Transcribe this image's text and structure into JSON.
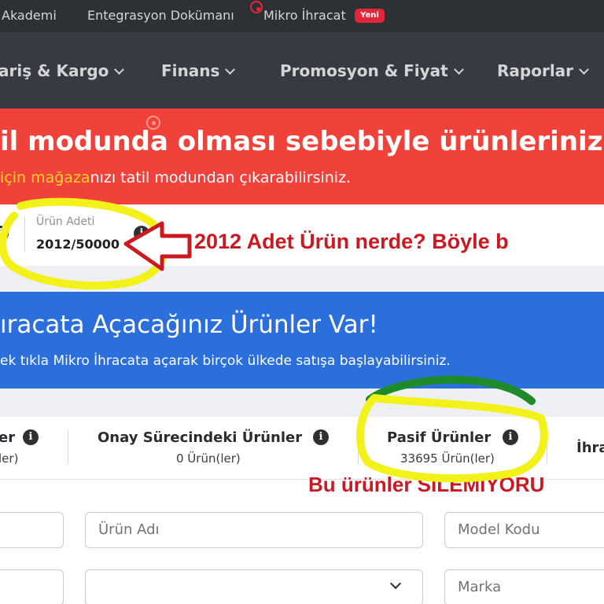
{
  "topbar": {
    "links": [
      "Akademi",
      "Entegrasyon Dokümanı",
      "Mikro İhracat"
    ],
    "new_badge": "Yeni"
  },
  "nav": {
    "items": [
      "ariş & Kargo",
      "Finans",
      "Promosyon & Fiyat",
      "Raporlar"
    ]
  },
  "vacation_banner": {
    "title": "il modunda olması sebebiyle ürünleriniz satış",
    "subtitle_highlight": "için mağaza",
    "subtitle_rest": "nızı tatil modundan çıkarabilirsiniz."
  },
  "product_count": {
    "label": "Ürün Adeti",
    "value": "2012/50000"
  },
  "annotations": {
    "where_products": "2012 Adet Ürün nerde? Böyle b",
    "cannot_delete": "Bu ürünler SİLEMİYORU"
  },
  "export_banner": {
    "title": "ıracata Açacağınız Ürünler Var!",
    "subtitle": "ek tıkla Mikro İhracata açarak birçok ülkede satışa başlayabilirsiniz."
  },
  "tabs": [
    {
      "title": "er",
      "sub": "ler)"
    },
    {
      "title": "Onay Sürecindeki Ürünler",
      "sub": "0 Ürün(ler)"
    },
    {
      "title": "Pasif Ürünler",
      "sub": "33695 Ürün(ler)"
    },
    {
      "title": "İhra",
      "sub": ""
    }
  ],
  "filters": {
    "product_name_placeholder": "Ürün Adı",
    "model_code_placeholder": "Model Kodu",
    "brand_placeholder": "Marka"
  },
  "colors": {
    "topbar_bg": "#2d3035",
    "navbar_bg": "#373b41",
    "vacation_red": "#f0413b",
    "export_blue": "#2a6fdb",
    "highlight_yellow": "#ffd42a",
    "annotation_red": "#cc1820",
    "marker_yellow": "#f2f21a"
  },
  "icons": {
    "info": "info-icon",
    "chevron": "chevron-down-icon",
    "notification": "notification-dot-icon",
    "arrow": "left-arrow-annotation-icon"
  }
}
